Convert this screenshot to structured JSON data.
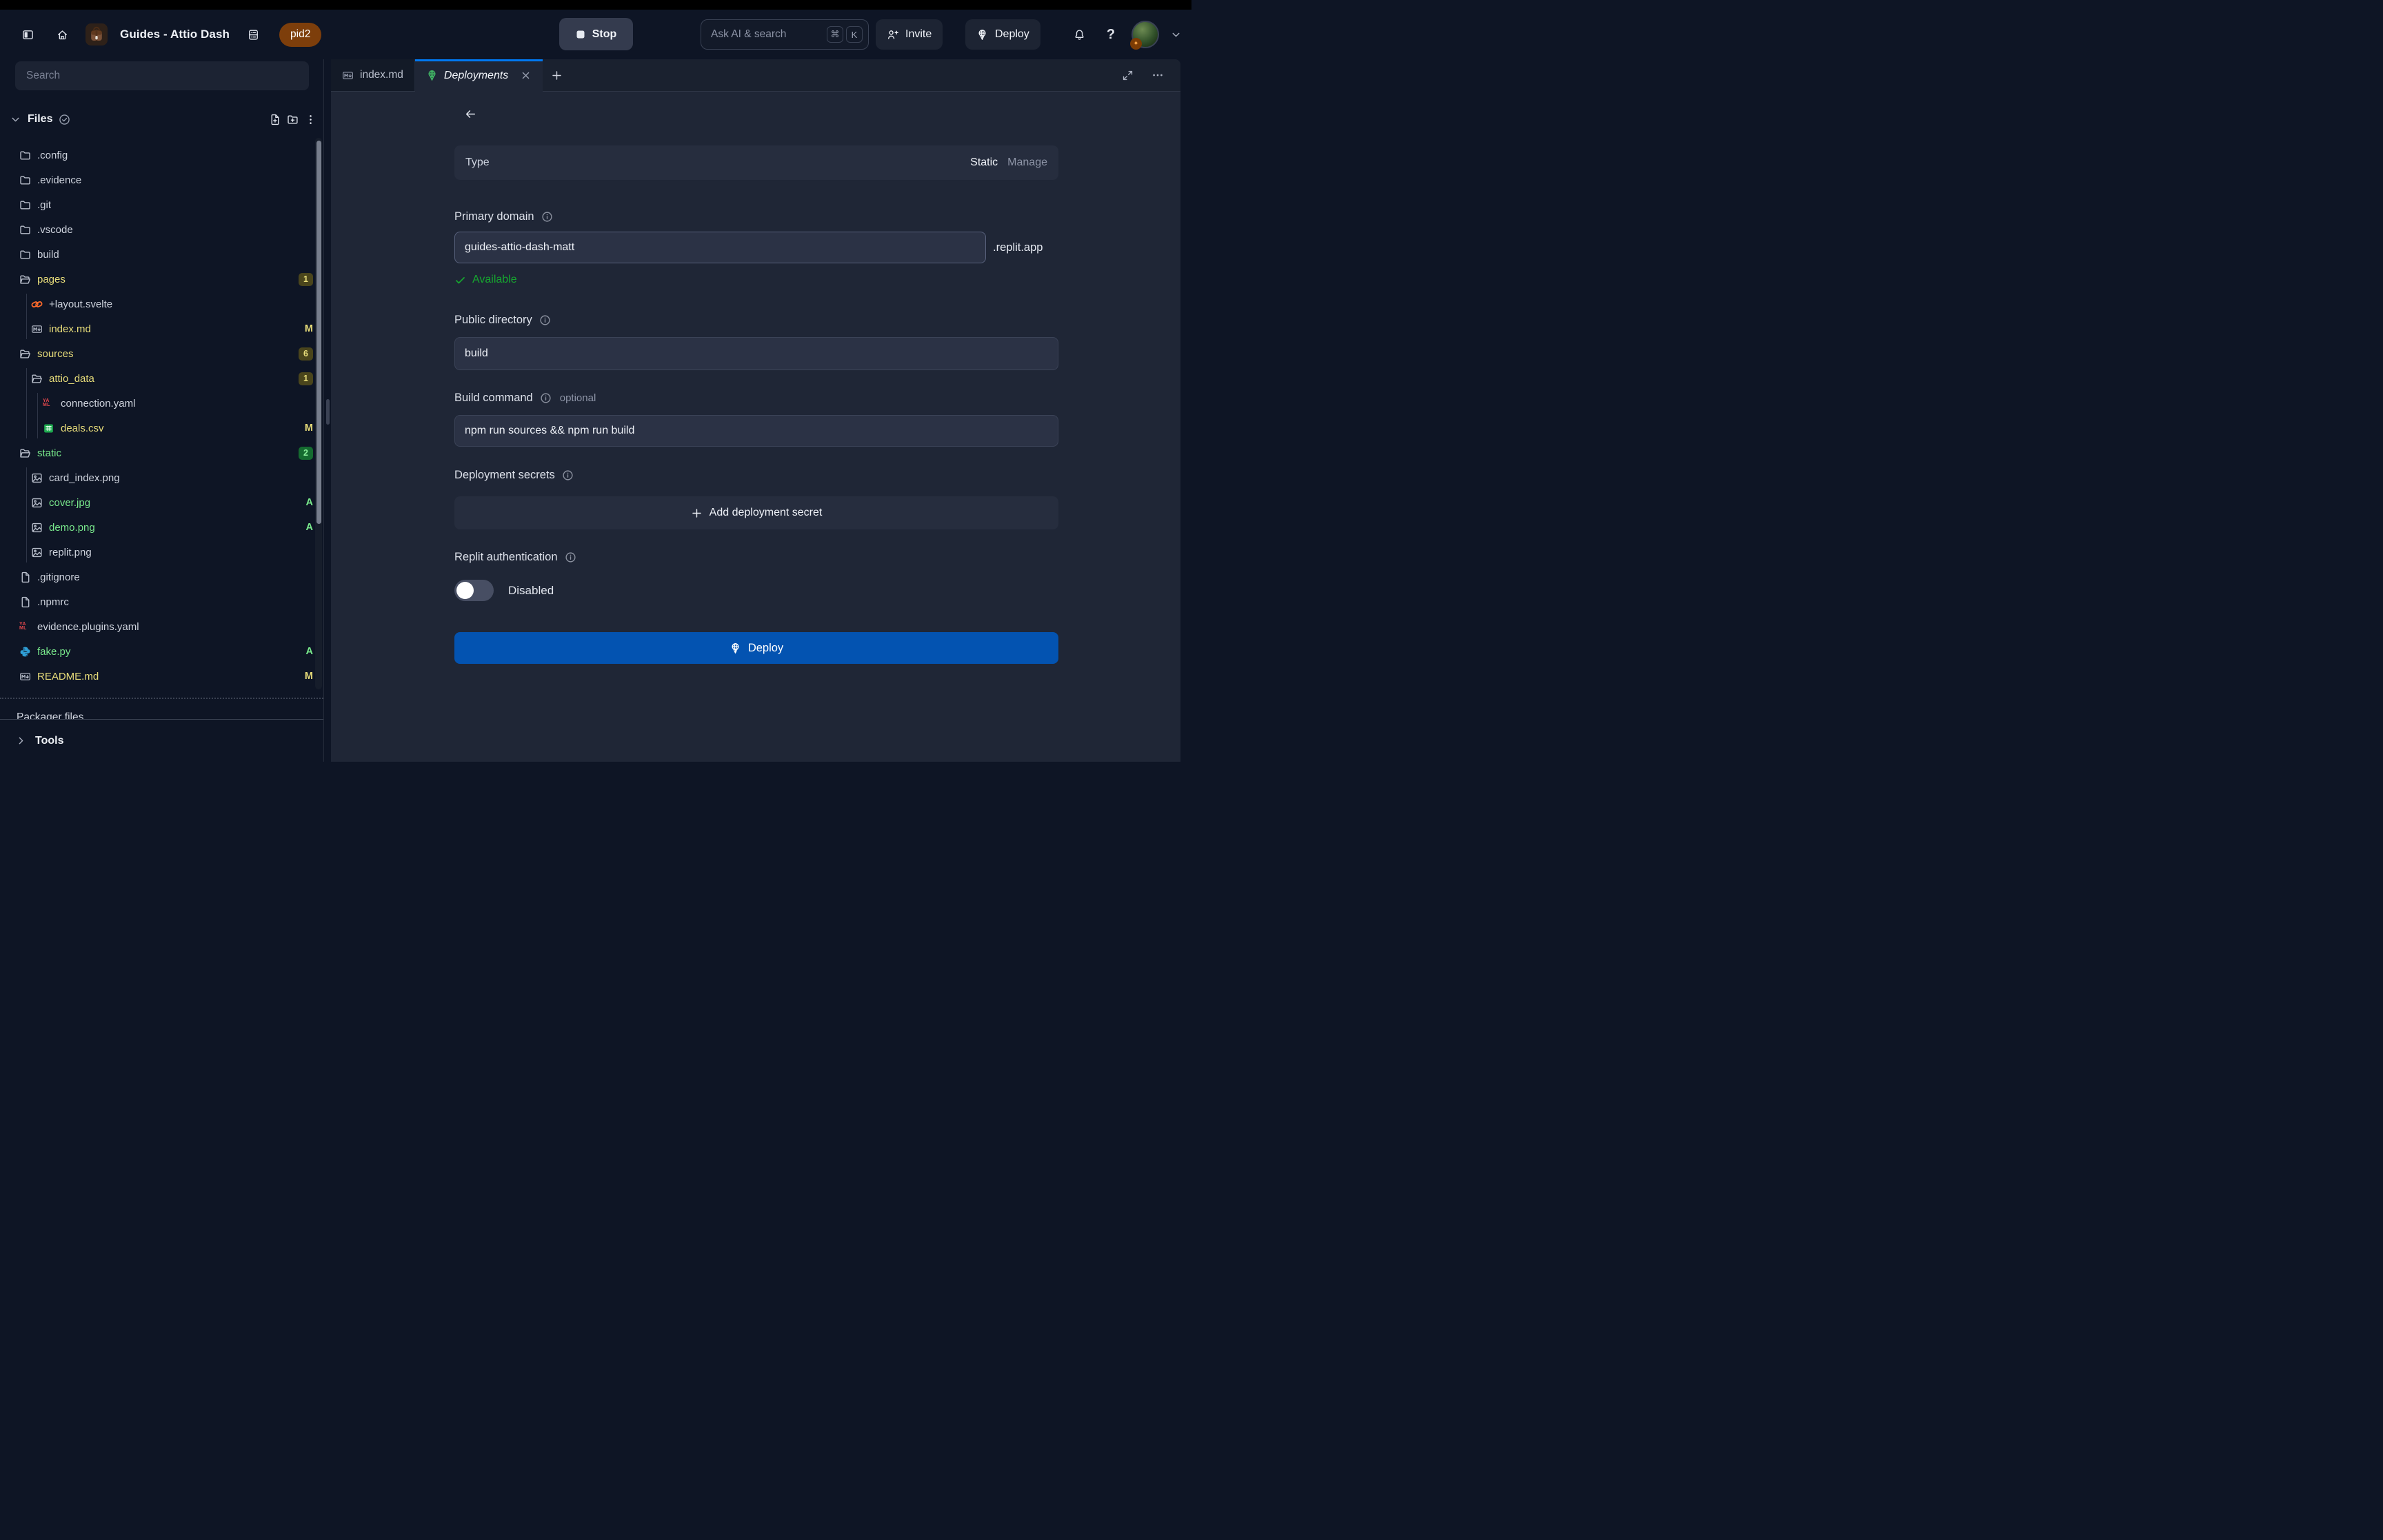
{
  "colors": {
    "page_bg": "#0e1525",
    "pane_bg": "#1f2636",
    "accent_blue": "#0079f2",
    "deploy_button_blue": "#0353b1",
    "modified_yellow": "#e8dd7a",
    "added_green": "#79e98c",
    "available_green": "#16a72f",
    "pid_badge_brown": "#7d3e0b"
  },
  "header": {
    "title": "Guides - Attio Dash",
    "pid_badge": "pid2",
    "stop_label": "Stop",
    "search_placeholder": "Ask AI & search",
    "key_cmd": "⌘",
    "key_k": "K",
    "invite_label": "Invite",
    "deploy_label": "Deploy",
    "icons": [
      "panel-toggle-icon",
      "home-icon",
      "repl-backpack-icon",
      "history-icon",
      "stop-icon",
      "command-key-icon",
      "invite-person-icon",
      "deploy-globe-icon",
      "bell-icon",
      "help-icon",
      "avatar",
      "chevron-down-icon"
    ]
  },
  "sidebar": {
    "search_placeholder": "Search",
    "files_header": "Files",
    "header_icons": [
      "chevron-down-icon",
      "check-circle-icon",
      "new-file-icon",
      "new-folder-icon",
      "kebab-menu-icon"
    ],
    "packager_label": "Packager files",
    "tools_label": "Tools",
    "tree": [
      {
        "name": ".config",
        "icon": "folder",
        "level": 0,
        "color": "default",
        "badge": null
      },
      {
        "name": ".evidence",
        "icon": "folder",
        "level": 0,
        "color": "default",
        "badge": null
      },
      {
        "name": ".git",
        "icon": "folder",
        "level": 0,
        "color": "default",
        "badge": null
      },
      {
        "name": ".vscode",
        "icon": "folder",
        "level": 0,
        "color": "default",
        "badge": null
      },
      {
        "name": "build",
        "icon": "folder",
        "level": 0,
        "color": "default",
        "badge": null
      },
      {
        "name": "pages",
        "icon": "folder-open",
        "level": 0,
        "color": "yellow",
        "badge": {
          "text": "1",
          "kind": "count-yellow"
        }
      },
      {
        "name": "+layout.svelte",
        "icon": "svelte",
        "level": 1,
        "color": "default",
        "badge": null
      },
      {
        "name": "index.md",
        "icon": "markdown",
        "level": 1,
        "color": "yellow",
        "badge": {
          "text": "M",
          "kind": "letter-yellow"
        }
      },
      {
        "name": "sources",
        "icon": "folder-open",
        "level": 0,
        "color": "yellow",
        "badge": {
          "text": "6",
          "kind": "count-yellow"
        }
      },
      {
        "name": "attio_data",
        "icon": "folder-open",
        "level": 1,
        "color": "yellow",
        "badge": {
          "text": "1",
          "kind": "count-yellow"
        }
      },
      {
        "name": "connection.yaml",
        "icon": "yaml",
        "level": 2,
        "color": "default",
        "badge": null
      },
      {
        "name": "deals.csv",
        "icon": "csv",
        "level": 2,
        "color": "yellow",
        "badge": {
          "text": "M",
          "kind": "letter-yellow"
        }
      },
      {
        "name": "static",
        "icon": "folder-open",
        "level": 0,
        "color": "green",
        "badge": {
          "text": "2",
          "kind": "count-green"
        }
      },
      {
        "name": "card_index.png",
        "icon": "image",
        "level": 1,
        "color": "default",
        "badge": null
      },
      {
        "name": "cover.jpg",
        "icon": "image",
        "level": 1,
        "color": "green",
        "badge": {
          "text": "A",
          "kind": "letter-green"
        }
      },
      {
        "name": "demo.png",
        "icon": "image",
        "level": 1,
        "color": "green",
        "badge": {
          "text": "A",
          "kind": "letter-green"
        }
      },
      {
        "name": "replit.png",
        "icon": "image",
        "level": 1,
        "color": "default",
        "badge": null
      },
      {
        "name": ".gitignore",
        "icon": "file",
        "level": 0,
        "color": "default",
        "badge": null
      },
      {
        "name": ".npmrc",
        "icon": "file",
        "level": 0,
        "color": "default",
        "badge": null
      },
      {
        "name": "evidence.plugins.yaml",
        "icon": "yaml",
        "level": 0,
        "color": "default",
        "badge": null
      },
      {
        "name": "fake.py",
        "icon": "python",
        "level": 0,
        "color": "green",
        "badge": {
          "text": "A",
          "kind": "letter-green"
        }
      },
      {
        "name": "README.md",
        "icon": "markdown",
        "level": 0,
        "color": "yellow",
        "badge": {
          "text": "M",
          "kind": "letter-yellow"
        }
      }
    ]
  },
  "tabs": [
    {
      "label": "index.md",
      "icon": "markdown-icon",
      "active": false
    },
    {
      "label": "Deployments",
      "icon": "deploy-globe-icon",
      "active": true
    }
  ],
  "deployments": {
    "type_label": "Type",
    "type_value": "Static",
    "manage_label": "Manage",
    "primary_domain_label": "Primary domain",
    "domain_value": "guides-attio-dash-matt",
    "domain_suffix": ".replit.app",
    "available_label": "Available",
    "public_dir_label": "Public directory",
    "public_dir_value": "build",
    "build_cmd_label": "Build command",
    "optional_label": "optional",
    "build_cmd_value": "npm run sources && npm run build",
    "secrets_label": "Deployment secrets",
    "add_secret_label": "Add deployment secret",
    "auth_label": "Replit authentication",
    "auth_state": "Disabled",
    "deploy_button_label": "Deploy"
  }
}
